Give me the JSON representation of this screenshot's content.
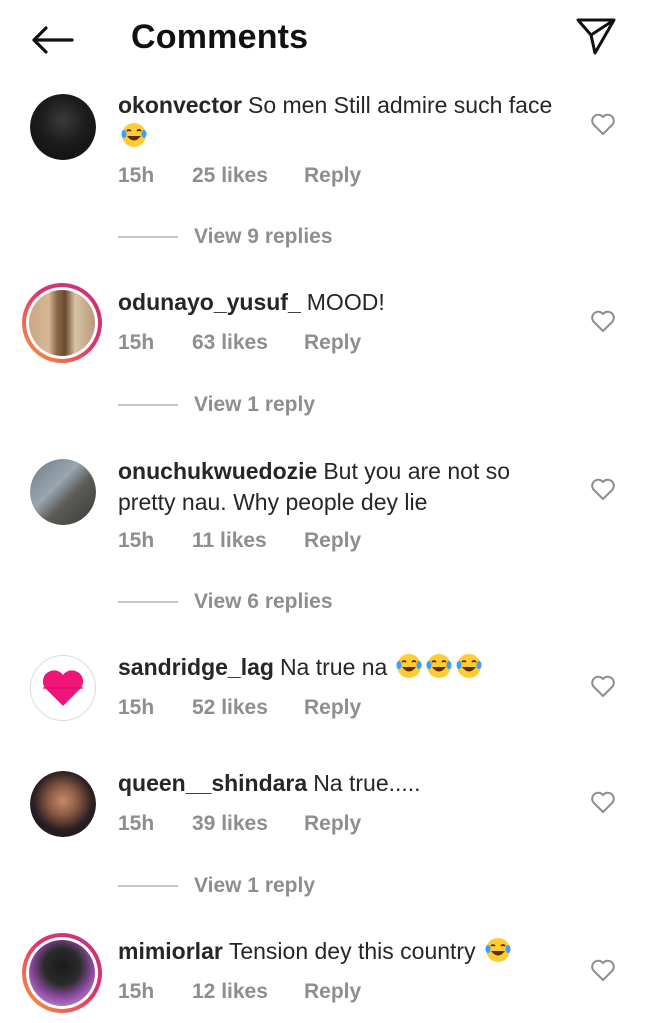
{
  "header": {
    "title": "Comments",
    "back_icon": "back-arrow-icon",
    "send_icon": "paper-plane-icon"
  },
  "comments": [
    {
      "user": "okonvector",
      "text": "So men Still admire such face",
      "emoji_count": 1,
      "time": "15h",
      "likes": "25 likes",
      "reply": "Reply",
      "view_replies": "View 9 replies"
    },
    {
      "user": "odunayo_yusuf_",
      "text": "MOOD!",
      "emoji_count": 0,
      "time": "15h",
      "likes": "63 likes",
      "reply": "Reply",
      "view_replies": "View 1 reply"
    },
    {
      "user": "onuchukwuedozie",
      "text": "But you are not so pretty nau. Why people dey lie",
      "emoji_count": 0,
      "time": "15h",
      "likes": "11 likes",
      "reply": "Reply",
      "view_replies": "View 6 replies"
    },
    {
      "user": "sandridge_lag",
      "text": "Na true na",
      "emoji_count": 3,
      "time": "15h",
      "likes": "52 likes",
      "reply": "Reply",
      "view_replies": ""
    },
    {
      "user": "queen__shindara",
      "text": "Na true.....",
      "emoji_count": 0,
      "time": "15h",
      "likes": "39 likes",
      "reply": "Reply",
      "view_replies": "View 1 reply"
    },
    {
      "user": "mimiorlar",
      "text": "Tension dey this country",
      "emoji_count": 1,
      "time": "15h",
      "likes": "12 likes",
      "reply": "Reply",
      "view_replies": ""
    }
  ],
  "colors": {
    "text": "#262626",
    "secondary": "#8e8e8e",
    "story_ring_start": "#f9a13a",
    "story_ring_end": "#c13584"
  }
}
